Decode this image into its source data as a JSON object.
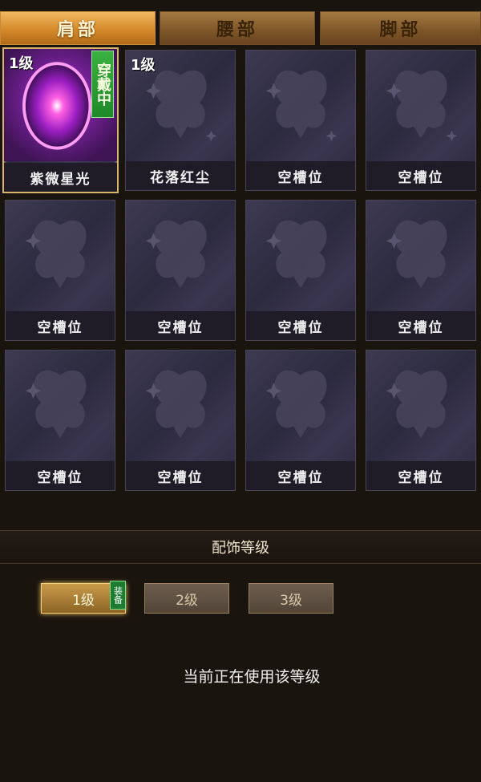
{
  "tabs": [
    {
      "label": "肩部",
      "active": true
    },
    {
      "label": "腰部",
      "active": false
    },
    {
      "label": "脚部",
      "active": false
    }
  ],
  "slots": [
    {
      "name": "紫微星光",
      "level": "1级",
      "wearing": "穿戴中"
    },
    {
      "name": "花落红尘",
      "level": "1级"
    },
    {
      "name": "空槽位"
    },
    {
      "name": "空槽位"
    },
    {
      "name": "空槽位"
    },
    {
      "name": "空槽位"
    },
    {
      "name": "空槽位"
    },
    {
      "name": "空槽位"
    },
    {
      "name": "空槽位"
    },
    {
      "name": "空槽位"
    },
    {
      "name": "空槽位"
    },
    {
      "name": "空槽位"
    }
  ],
  "section": {
    "title": "配饰等级"
  },
  "level_buttons": [
    {
      "label": "1级",
      "active": true
    },
    {
      "label": "2级",
      "active": false
    },
    {
      "label": "3级",
      "active": false
    }
  ],
  "equip_badge": "装备",
  "status": "当前正在使用该等级",
  "colors": {
    "accent_gold": "#d8b46a",
    "equip_green": "#1f8a2a",
    "slot_bg": "#2c2a3e"
  }
}
